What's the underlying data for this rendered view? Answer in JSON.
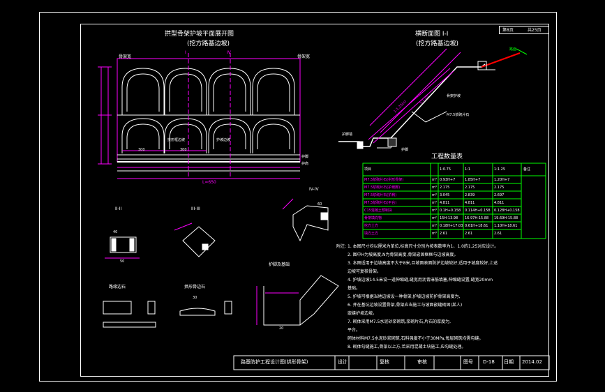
{
  "sheet": {
    "no_label": "第8页",
    "total_label": "共25页"
  },
  "plan_view": {
    "title": "拱型骨架护坡平面展开图",
    "subtitle": "(挖方路基边坡)",
    "section_mark_a": "I",
    "section_mark_b": "IV",
    "left_label": "骨架宽 ",
    "right_label": "骨架宽 ",
    "width_label": "L=650",
    "dim_300": "300",
    "dim_300b": "300",
    "arch_label": "拱形框边坡",
    "arch_label2": "护坡边坡",
    "side_label": "护脚",
    "side_label2": "护肩"
  },
  "section_view": {
    "title": "横断面图 I-I",
    "subtitle": "(挖方路基边坡)",
    "slope1": "1:1.25(n)",
    "slope2": "1:1.25",
    "label_a": "护脚墙",
    "label_b": "骨架护坡",
    "label_c": "M7.5浆砌片石",
    "label_d": "护脚",
    "label_e": "路面"
  },
  "table": {
    "title": "工程数量表",
    "headers": [
      "项目",
      "",
      "1:0.75",
      "1:1",
      "1:1.25",
      "备注"
    ],
    "rows": [
      [
        "M7.5浆砌片石(拱形骨架)",
        "m³",
        "0.93H+7",
        "1.85H+7",
        "1.20H+7",
        ""
      ],
      [
        "M7.5浆砌片石(护坡脚)",
        "m³",
        "2.175",
        "2.175",
        "2.175",
        ""
      ],
      [
        "M7.5浆砌片石(护肩)",
        "m³",
        "3.045",
        "2.839",
        "2.697",
        ""
      ],
      [
        "M7.5浆砌片石(平台)",
        "m³",
        "4.811",
        "4.811",
        "4.811",
        ""
      ],
      [
        "C15混凝土预制块",
        "m³",
        "0.1H+0.158",
        "0.114H+0.158",
        "0.128H+0.158",
        ""
      ],
      [
        "骨架填充物",
        "m²",
        "15H-13.98",
        "16.97H-15.88",
        "19.69H-15.88",
        ""
      ],
      [
        "挖方土方",
        "m³",
        "0.18H+17.03",
        "0.61H+18.61",
        "1.10H+18.61",
        ""
      ],
      [
        "填方土方",
        "m³",
        "2.61",
        "2.61",
        "2.61",
        ""
      ]
    ]
  },
  "details": {
    "sec2": "II-II",
    "sec3": "III-III",
    "sec4": "IV-IV",
    "curb": "路缘边石",
    "edge": "拱形骨边石",
    "cap": "护脚及基础",
    "d40": "40",
    "d50": "50",
    "d60": "60",
    "d30": "30",
    "d20": "20"
  },
  "notes": {
    "label": "附注:",
    "lines": [
      "1. 本图尺寸均以厘米为单位,标高尺寸分别为按表数率为1、1.0的1.25对应设计。",
      "2. 图中H为坡高度,N为骨架高度,骨架嵌固框框与边坡高度。",
      "3. 本图适用于边坡高度不大于8米,且坡面表面防护边坡较好,适用于坡度较好,上述",
      "    边坡可复核骨架。",
      "4. 护坡边坡14.5米设一道伸缩缝,缝宽用沥青麻筋填塞,伸缩缝设置,缝宽20mm",
      "    基础。",
      "5. 护坡可根据当地边坡设一种骨架,护坡边坡防护骨架高度为,",
      "6. 并在基坑边坡设置骨架,骨架应当施工与坡面嵌缝砌固(某人)",
      "    嵌缝护坡边坡。",
      "7. 砌体采用M7.5水泥砂浆砌筑,浆砌片石,片石的厚度为,",
      "    平台。",
      "    砌体材料M7.5水泥砂浆砌筑,石料强度不小于30MPa,每层砌筑均需勾缝。",
      "8. 砌体勾缝施工,骨架以上方,若采用混凝土块施工,应勾缝处理。"
    ]
  },
  "title_block": {
    "project": "路基防护工程设计图(拱形骨架)",
    "design": "设计",
    "review": "复核",
    "audit": "审核",
    "drawing_no_label": "图号",
    "drawing_no": "D-18",
    "date_label": "日期",
    "date": "2014.02"
  },
  "colors": {
    "line": "#ffffff",
    "magenta": "#ff00ff",
    "cyan": "#00e5ff",
    "yellow": "#ffff00",
    "green": "#00ff00",
    "red": "#ff0000",
    "blue": "#4060ff"
  }
}
